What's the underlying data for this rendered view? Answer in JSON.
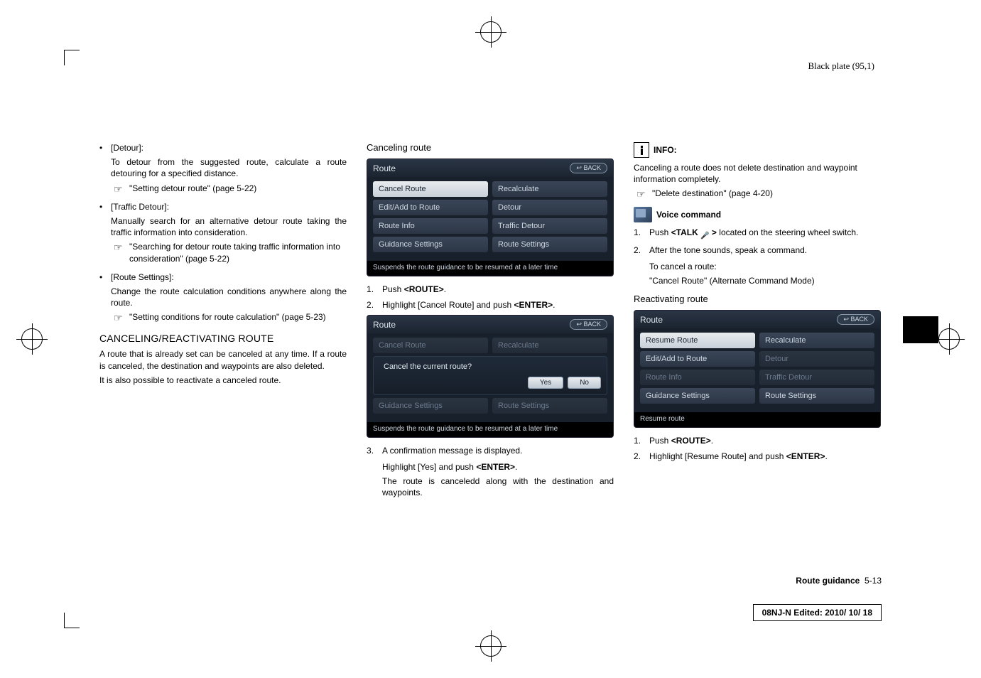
{
  "plate": "Black plate (95,1)",
  "col1": {
    "items": [
      {
        "title": "[Detour]:",
        "desc": "To detour from the suggested route, calculate a route detouring for a specified distance.",
        "ref": "\"Setting detour route\" (page 5-22)"
      },
      {
        "title": "[Traffic Detour]:",
        "desc": "Manually search for an alternative detour route taking the traffic information into consideration.",
        "ref": "\"Searching for detour route taking traffic information into consideration\" (page 5-22)"
      },
      {
        "title": "[Route Settings]:",
        "desc": "Change the route calculation conditions anywhere along the route.",
        "ref": "\"Setting conditions for route calculation\" (page 5-23)"
      }
    ],
    "h2": "CANCELING/REACTIVATING ROUTE",
    "h2p1": "A route that is already set can be canceled at any time. If a route is canceled, the destination and waypoints are also deleted.",
    "h2p2": "It is also possible to reactivate a canceled route."
  },
  "col2": {
    "h3": "Canceling route",
    "nav1": {
      "title": "Route",
      "back": "BACK",
      "rows": [
        [
          "Cancel Route",
          "Recalculate"
        ],
        [
          "Edit/Add to Route",
          "Detour"
        ],
        [
          "Route Info",
          "Traffic Detour"
        ],
        [
          "Guidance Settings",
          "Route Settings"
        ]
      ],
      "foot": "Suspends the route guidance to be resumed at a later time"
    },
    "step1": "Push <ROUTE>.",
    "step2": "Highlight [Cancel Route] and push <ENTER>.",
    "nav2": {
      "title": "Route",
      "back": "BACK",
      "dimrows": [
        [
          "Cancel Route",
          "Recalculate"
        ]
      ],
      "dialog_q": "Cancel the current route?",
      "yes": "Yes",
      "no": "No",
      "bottomrows": [
        [
          "Guidance Settings",
          "Route Settings"
        ]
      ],
      "foot": "Suspends the route guidance to be resumed at a later time"
    },
    "step3a": "A confirmation message is displayed.",
    "step3b": "Highlight [Yes] and push <ENTER>.",
    "step3c": "The route is canceledd along with the destination and waypoints."
  },
  "col3": {
    "info_label": "INFO:",
    "info_p": "Canceling a route does not delete destination and waypoint information completely.",
    "info_ref": "\"Delete destination\" (page 4-20)",
    "vc_label": "Voice command",
    "vc1": "Push <TALK  > located on the steering wheel switch.",
    "vc2": "After the tone sounds, speak a command.",
    "vc2a": "To cancel a route:",
    "vc2b": "\"Cancel Route\" (Alternate Command Mode)",
    "h3": "Reactivating route",
    "nav3": {
      "title": "Route",
      "back": "BACK",
      "rows": [
        {
          "l": "Resume Route",
          "r": "Recalculate",
          "lon": true
        },
        {
          "l": "Edit/Add to Route",
          "r": "Detour",
          "rdim": true
        },
        {
          "l": "Route Info",
          "r": "Traffic Detour",
          "ldim": true,
          "rdim": true
        },
        {
          "l": "Guidance Settings",
          "r": "Route Settings"
        }
      ],
      "foot": "Resume route"
    },
    "r1": "Push <ROUTE>.",
    "r2": "Highlight [Resume Route] and push <ENTER>."
  },
  "footer": {
    "chapter": "Route guidance",
    "page": "5-13"
  },
  "editline": "08NJ-N Edited:  2010/ 10/ 18"
}
